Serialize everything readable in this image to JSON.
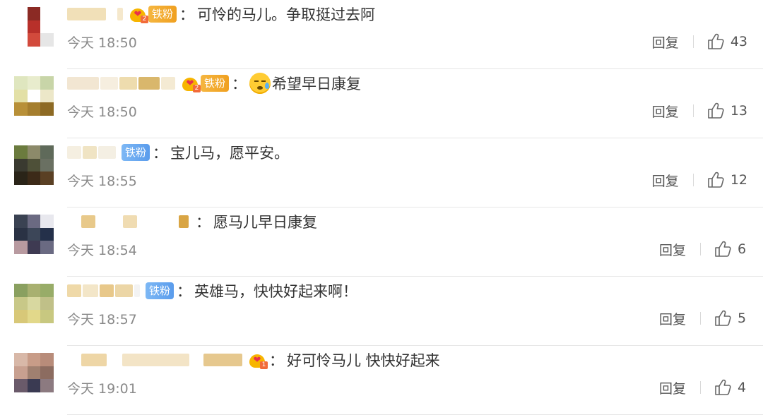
{
  "comments": [
    {
      "badge": "铁粉",
      "badge_style": "gold",
      "crown": true,
      "crown_level": "2",
      "emoji": false,
      "text": "可怜的马儿。争取挺过去阿",
      "time": "今天 18:50",
      "reply": "回复",
      "likes": "43",
      "avatar": [
        "#ffffff",
        "#8b2a24",
        "#ffffff",
        "#ffffff",
        "#b8302a",
        "#ffffff",
        "#ffffff",
        "#d24a3c",
        "#e6e6e6"
      ],
      "name_blocks": [
        {
          "w": 55,
          "c": "#f1e0b8"
        },
        {
          "w": 12,
          "c": "#ffffff"
        },
        {
          "w": 8,
          "c": "#f5e8cc"
        }
      ]
    },
    {
      "badge": "铁粉",
      "badge_style": "gold",
      "crown": true,
      "crown_level": "2",
      "emoji": true,
      "text": "希望早日康复",
      "time": "今天 18:50",
      "reply": "回复",
      "likes": "13",
      "avatar": [
        "#dfe6bf",
        "#e8eccd",
        "#c8d5a8",
        "#e3e0a6",
        "#ffffff",
        "#ece7c8",
        "#b89038",
        "#a57e2e",
        "#8d6a24"
      ],
      "name_blocks": [
        {
          "w": 45,
          "c": "#f2e6d2"
        },
        {
          "w": 25,
          "c": "#f6eedf"
        },
        {
          "w": 25,
          "c": "#eedcae"
        },
        {
          "w": 30,
          "c": "#d9b76c"
        },
        {
          "w": 20,
          "c": "#f4ead3"
        }
      ]
    },
    {
      "badge": "铁粉",
      "badge_style": "blue",
      "crown": false,
      "crown_level": "",
      "emoji": false,
      "text": "宝儿马，愿平安。",
      "time": "今天 18:55",
      "reply": "回复",
      "likes": "12",
      "avatar": [
        "#6b7b3e",
        "#8c8a6a",
        "#5f6a5a",
        "#3a3a30",
        "#4e5038",
        "#6a7062",
        "#2a2418",
        "#3c2a18",
        "#5a4024"
      ],
      "name_blocks": [
        {
          "w": 20,
          "c": "#f5efe1"
        },
        {
          "w": 20,
          "c": "#f0e4c4"
        },
        {
          "w": 25,
          "c": "#f4efe3"
        }
      ]
    },
    {
      "badge": "",
      "badge_style": "",
      "crown": false,
      "crown_level": "",
      "emoji": false,
      "text": "愿马儿早日康复",
      "time": "今天 18:54",
      "reply": "回复",
      "likes": "6",
      "avatar": [
        "#3a4252",
        "#6b6a82",
        "#e8e8ee",
        "#2a3244",
        "#3c4658",
        "#24304a",
        "#b89aa0",
        "#3e3a52",
        "#6a6a82"
      ],
      "name_blocks": [
        {
          "w": 18,
          "c": "#ffffff"
        },
        {
          "w": 20,
          "c": "#e8c98a"
        },
        {
          "w": 35,
          "c": "#ffffff"
        },
        {
          "w": 20,
          "c": "#f0dcb2"
        },
        {
          "w": 55,
          "c": "#ffffff"
        },
        {
          "w": 14,
          "c": "#d9a544"
        }
      ]
    },
    {
      "badge": "铁粉",
      "badge_style": "blue",
      "crown": false,
      "crown_level": "",
      "emoji": false,
      "text": "英雄马，快快好起来啊！",
      "time": "今天 18:57",
      "reply": "回复",
      "likes": "5",
      "avatar": [
        "#8aa060",
        "#a8b070",
        "#98ac68",
        "#c8c888",
        "#d8d8a0",
        "#c0c088",
        "#d8c878",
        "#e2d88a",
        "#c8c880"
      ],
      "name_blocks": [
        {
          "w": 20,
          "c": "#efd9a8"
        },
        {
          "w": 22,
          "c": "#f3e6c8"
        },
        {
          "w": 20,
          "c": "#e8c88a"
        },
        {
          "w": 25,
          "c": "#ecd6a6"
        },
        {
          "w": 8,
          "c": "#f3f3f3"
        }
      ]
    },
    {
      "badge": "",
      "badge_style": "",
      "crown": true,
      "crown_level": "1",
      "emoji": false,
      "text": "好可怜马儿 快快好起来",
      "time": "今天 19:01",
      "reply": "回复",
      "likes": "4",
      "avatar": [
        "#d8b8a8",
        "#c89c88",
        "#b88c7a",
        "#c8a090",
        "#a08070",
        "#8c6c60",
        "#6a5a6a",
        "#3a3a52",
        "#8c7a80"
      ],
      "name_blocks": [
        {
          "w": 18,
          "c": "#ffffff"
        },
        {
          "w": 36,
          "c": "#eed6a6"
        },
        {
          "w": 18,
          "c": "#ffffff"
        },
        {
          "w": 95,
          "c": "#f3e4c6"
        },
        {
          "w": 16,
          "c": "#ffffff"
        },
        {
          "w": 55,
          "c": "#e6c88e"
        }
      ]
    }
  ]
}
